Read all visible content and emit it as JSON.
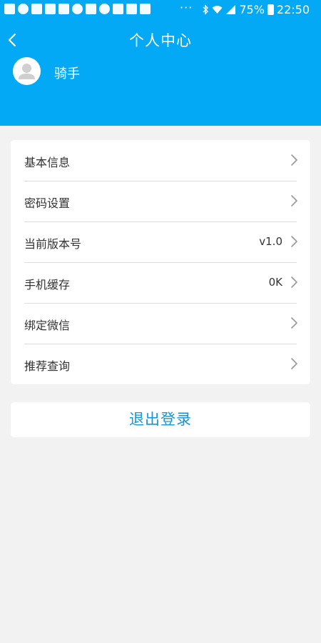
{
  "status_bar": {
    "battery": "75%",
    "time": "22:50",
    "dots": "···"
  },
  "header": {
    "title": "个人中心",
    "username": "骑手"
  },
  "menu": {
    "items": [
      {
        "label": "基本信息",
        "value": ""
      },
      {
        "label": "密码设置",
        "value": ""
      },
      {
        "label": "当前版本号",
        "value": "v1.0"
      },
      {
        "label": "手机缓存",
        "value": "0K"
      },
      {
        "label": "绑定微信",
        "value": ""
      },
      {
        "label": "推荐查询",
        "value": ""
      }
    ]
  },
  "logout": {
    "label": "退出登录"
  },
  "colors": {
    "header_bg": "#03a9f4",
    "page_bg": "#f2f2f2",
    "logout_text": "#1296db"
  }
}
